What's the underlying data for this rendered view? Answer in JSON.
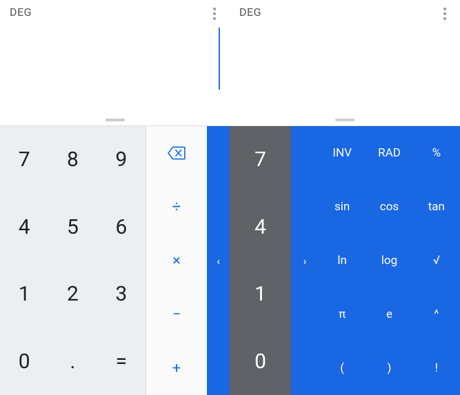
{
  "left": {
    "mode": "DEG",
    "numpad": [
      "7",
      "8",
      "9",
      "4",
      "5",
      "6",
      "1",
      "2",
      "3",
      "0",
      ".",
      "="
    ],
    "ops": {
      "div": "÷",
      "mul": "×",
      "sub": "−",
      "add": "+"
    },
    "chevron": "‹"
  },
  "right": {
    "mode": "DEG",
    "numcol": [
      "7",
      "4",
      "1",
      "0"
    ],
    "chevron": "›",
    "sci": {
      "r0": [
        "INV",
        "RAD",
        "%"
      ],
      "r1": [
        "sin",
        "cos",
        "tan"
      ],
      "r2": [
        "ln",
        "log",
        "√"
      ],
      "r3": [
        "π",
        "e",
        "^"
      ],
      "r4": [
        "(",
        ")",
        "!"
      ]
    }
  }
}
